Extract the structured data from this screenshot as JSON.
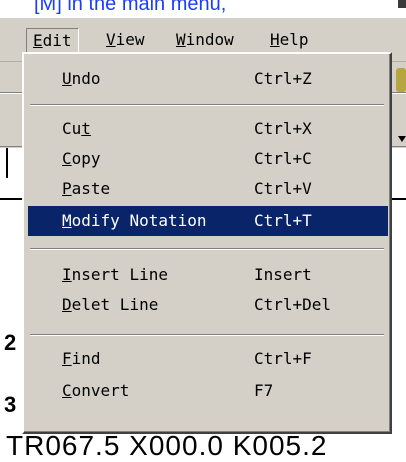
{
  "banner": {
    "text": "[M] in the main menu,"
  },
  "menubar": {
    "items": [
      {
        "label": "Edit",
        "mnemonic": "E",
        "rest": "dit"
      },
      {
        "label": "View",
        "mnemonic": "V",
        "rest": "iew"
      },
      {
        "label": "Window",
        "mnemonic": "W",
        "rest": "indow"
      },
      {
        "label": "Help",
        "mnemonic": "H",
        "rest": "elp"
      }
    ]
  },
  "edit_menu": {
    "items": [
      {
        "label": "Undo",
        "pre": "",
        "mnemonic": "U",
        "rest": "ndo",
        "shortcut": "Ctrl+Z"
      },
      {
        "label": "Cut",
        "pre": "Cu",
        "mnemonic": "t",
        "rest": "",
        "shortcut": "Ctrl+X"
      },
      {
        "label": "Copy",
        "pre": "",
        "mnemonic": "C",
        "rest": "opy",
        "shortcut": "Ctrl+C"
      },
      {
        "label": "Paste",
        "pre": "",
        "mnemonic": "P",
        "rest": "aste",
        "shortcut": "Ctrl+V"
      },
      {
        "label": "Modify Notation",
        "pre": "",
        "mnemonic": "M",
        "rest": "odify Notation",
        "shortcut": "Ctrl+T",
        "highlighted": true
      },
      {
        "label": "Insert Line",
        "pre": "",
        "mnemonic": "I",
        "rest": "nsert Line",
        "shortcut": "Insert"
      },
      {
        "label": "Delet Line",
        "pre": "",
        "mnemonic": "D",
        "rest": "elet Line",
        "shortcut": "Ctrl+Del"
      },
      {
        "label": "Find",
        "pre": "",
        "mnemonic": "F",
        "rest": "ind",
        "shortcut": "Ctrl+F"
      },
      {
        "label": "Convert",
        "pre": "",
        "mnemonic": "C",
        "rest": "onvert",
        "shortcut": "F7"
      }
    ]
  },
  "background": {
    "bottom_text": "TR067.5  X000.0  K005.2",
    "frag_a": "2",
    "frag_b": "3"
  },
  "colors": {
    "menu_face": "#d4d0c8",
    "highlight": "#0a246a",
    "banner_text": "#1a3cff"
  }
}
